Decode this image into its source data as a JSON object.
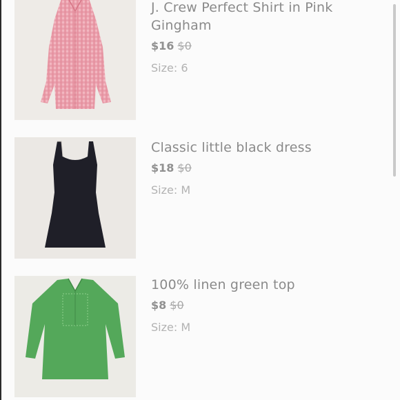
{
  "listings": [
    {
      "title": "J. Crew Perfect Shirt in Pink Gingham",
      "price": "$16",
      "original_price": "$0",
      "size_label": "Size: 6",
      "image_icon": "pink-gingham-shirt-image"
    },
    {
      "title": "Classic little black dress",
      "price": "$18",
      "original_price": "$0",
      "size_label": "Size: M",
      "image_icon": "black-dress-image"
    },
    {
      "title": "100% linen green top",
      "price": "$8",
      "original_price": "$0",
      "size_label": "Size: M",
      "image_icon": "green-linen-top-image"
    }
  ],
  "colors": {
    "background": "#fbfbfb",
    "title_text": "#8a8a8a",
    "price_text": "#909090",
    "size_text": "#b2b2b2"
  }
}
